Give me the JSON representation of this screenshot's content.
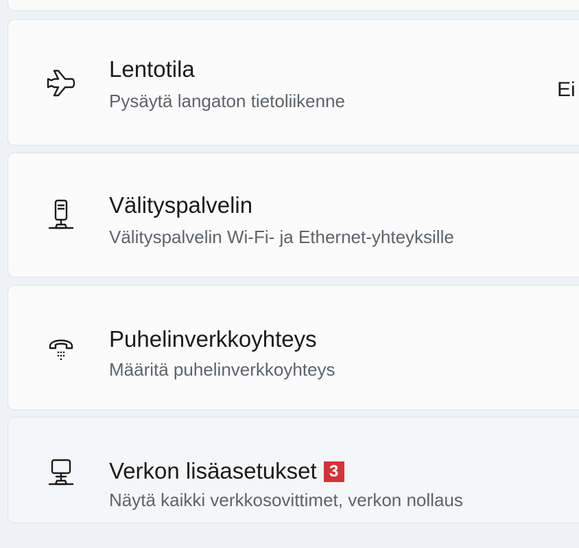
{
  "settings": {
    "items": [
      {
        "title": "Lentotila",
        "subtitle": "Pysäytä langaton tietoliikenne",
        "value": "Ei",
        "icon": "airplane-icon"
      },
      {
        "title": "Välityspalvelin",
        "subtitle": "Välityspalvelin Wi-Fi- ja Ethernet-yhteyksille",
        "icon": "proxy-server-icon"
      },
      {
        "title": "Puhelinverkkoyhteys",
        "subtitle": "Määritä puhelinverkkoyhteys",
        "icon": "dial-up-phone-icon"
      },
      {
        "title": "Verkon lisäasetukset",
        "subtitle": "Näytä kaikki verkkosovittimet, verkon nollaus",
        "badge": "3",
        "icon": "network-computer-icon"
      }
    ]
  },
  "colors": {
    "background": "#eef1f6",
    "card": "#fbfbfc",
    "card_hover": "#f5f6f8",
    "title_text": "#1b1b1b",
    "subtitle_text": "#5f6368",
    "badge": "#d13438"
  }
}
